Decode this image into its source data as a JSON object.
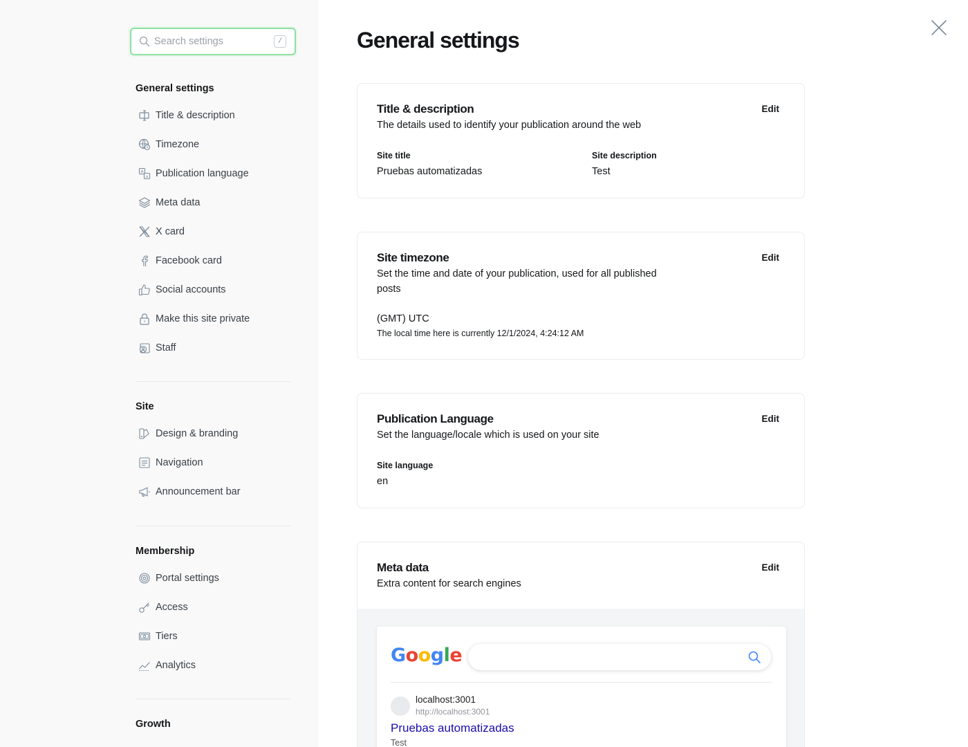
{
  "search": {
    "placeholder": "Search settings",
    "shortcut": "/"
  },
  "sidebar": {
    "groups": [
      {
        "heading": "General settings",
        "items": [
          {
            "label": "Title & description",
            "icon": "title-icon"
          },
          {
            "label": "Timezone",
            "icon": "globe-clock-icon"
          },
          {
            "label": "Publication language",
            "icon": "language-icon"
          },
          {
            "label": "Meta data",
            "icon": "layers-icon"
          },
          {
            "label": "X card",
            "icon": "x-logo-icon"
          },
          {
            "label": "Facebook card",
            "icon": "facebook-icon"
          },
          {
            "label": "Social accounts",
            "icon": "thumbs-up-icon"
          },
          {
            "label": "Make this site private",
            "icon": "lock-icon"
          },
          {
            "label": "Staff",
            "icon": "staff-icon"
          }
        ]
      },
      {
        "heading": "Site",
        "items": [
          {
            "label": "Design & branding",
            "icon": "paint-brush-icon"
          },
          {
            "label": "Navigation",
            "icon": "navigation-icon"
          },
          {
            "label": "Announcement bar",
            "icon": "megaphone-icon"
          }
        ]
      },
      {
        "heading": "Membership",
        "items": [
          {
            "label": "Portal settings",
            "icon": "portal-icon"
          },
          {
            "label": "Access",
            "icon": "key-icon"
          },
          {
            "label": "Tiers",
            "icon": "money-icon"
          },
          {
            "label": "Analytics",
            "icon": "analytics-icon"
          }
        ]
      },
      {
        "heading": "Growth",
        "items": []
      }
    ]
  },
  "main": {
    "title": "General settings",
    "edit_label": "Edit",
    "cards": {
      "title_description": {
        "title": "Title & description",
        "description": "The details used to identify your publication around the web",
        "site_title_label": "Site title",
        "site_title_value": "Pruebas automatizadas",
        "site_description_label": "Site description",
        "site_description_value": "Test"
      },
      "timezone": {
        "title": "Site timezone",
        "description": "Set the time and date of your publication, used for all published posts",
        "value": "(GMT) UTC",
        "local_time": "The local time here is currently 12/1/2024, 4:24:12 AM"
      },
      "language": {
        "title": "Publication Language",
        "description": "Set the language/locale which is used on your site",
        "site_language_label": "Site language",
        "site_language_value": "en"
      },
      "meta": {
        "title": "Meta data",
        "description": "Extra content for search engines",
        "preview": {
          "logo": "Google",
          "site_name": "localhost:3001",
          "url": "http://localhost:3001",
          "result_title": "Pruebas automatizadas",
          "result_description": "Test"
        }
      }
    }
  },
  "colors": {
    "sidebar_bg": "#f9f9f9",
    "search_focus": "#8fe0a0",
    "google_blue": "#4285f4",
    "google_red": "#ea4335",
    "google_yellow": "#fbbc05",
    "google_green": "#34a853",
    "result_link": "#1a0dab"
  }
}
